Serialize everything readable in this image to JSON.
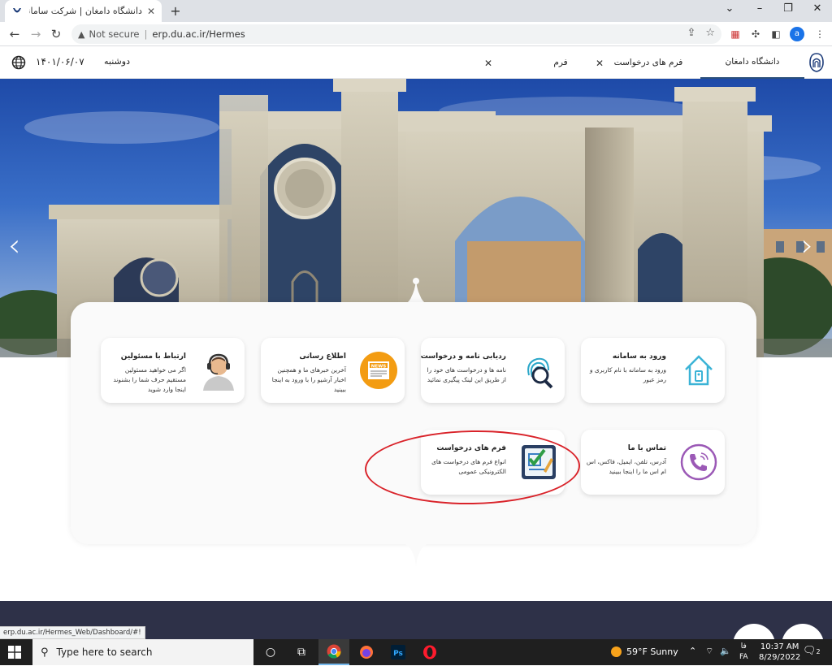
{
  "browser": {
    "tab_title": "دانشگاه دامغان | شرکت سامانه سار",
    "address": {
      "security_label": "Not secure",
      "url": "erp.du.ac.ir/Hermes"
    },
    "profile_letter": "a",
    "status_url": "erp.du.ac.ir/Hermes_Web/Dashboard/#!"
  },
  "appbar": {
    "date": "۱۴۰۱/۰۶/۰۷",
    "weekday": "دوشنبه",
    "tabs": [
      {
        "label": "دانشگاه دامغان",
        "active": true
      },
      {
        "label": "فرم های درخواست",
        "active": false
      },
      {
        "label": "فرم",
        "active": false
      }
    ]
  },
  "cards": [
    {
      "title": "ورود به سامانه",
      "desc": "ورود به سامانه با نام کاربری و رمز عبور",
      "icon": "house-key-icon"
    },
    {
      "title": "ردیابی نامه و درخواست ها",
      "desc": "نامه ها و درخواست های خود را از طریق این لینک پیگیری نمائید",
      "icon": "fingerprint-search-icon"
    },
    {
      "title": "اطلاع رسانی",
      "desc": "آخرین خبرهای ما و همچنین اخبار آرشیو را با ورود به اینجا ببینید",
      "icon": "news-icon"
    },
    {
      "title": "ارتباط با مسئولین",
      "desc": "اگر می خواهید مسئولین مستقیم حرف شما را بشنوند اینجا وارد شوید",
      "icon": "support-agent-icon"
    },
    {
      "title": "تماس با ما",
      "desc": "آدرس، تلفن، ایمیل، فاکس، اس ام اس ما را اینجا ببینید",
      "icon": "phone-icon"
    },
    {
      "title": "فرم های درخواست",
      "desc": "انواع فرم های درخواست های الکترونیکی عمومی",
      "icon": "form-checklist-icon"
    }
  ],
  "taskbar": {
    "search_placeholder": "Type here to search",
    "weather": "59°F  Sunny",
    "lang_top": "فا",
    "lang_bottom": "FA",
    "time": "10:37 AM",
    "date": "8/29/2022",
    "notification_count": "2"
  }
}
